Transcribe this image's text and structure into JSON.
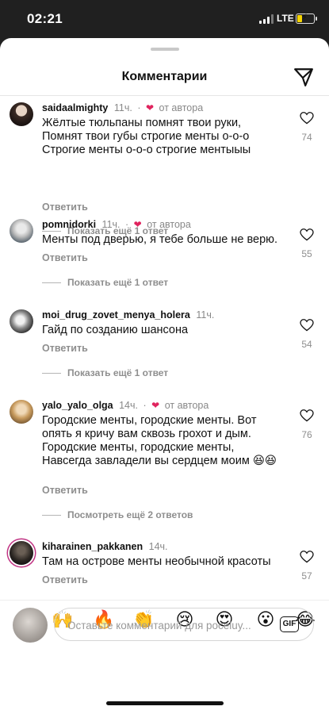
{
  "status_bar": {
    "time": "02:21",
    "network": "LTE"
  },
  "sheet": {
    "title": "Комментарии"
  },
  "comments": [
    {
      "username": "saidaalmighty",
      "time": "11ч.",
      "by_author": "от автора",
      "text": "Жёлтые тюльпаны помнят твои руки, Помнят твои губы строгие менты о-о-о Строгие менты о-о-о строгие ментыыы",
      "reply": "Ответить",
      "likes": "74",
      "more_replies": "Показать ещё 1 ответ"
    },
    {
      "username": "pomnidorki",
      "time": "11ч.",
      "by_author": "от автора",
      "text": "Менты под дверью, я тебе больше не верю.",
      "reply": "Ответить",
      "likes": "55",
      "more_replies": "Показать ещё 1 ответ"
    },
    {
      "username": "moi_drug_zovet_menya_holera",
      "time": "11ч.",
      "text": "Гайд по созданию шансона",
      "reply": "Ответить",
      "likes": "54",
      "more_replies": "Показать ещё 1 ответ"
    },
    {
      "username": "yalo_yalo_olga",
      "time": "14ч.",
      "by_author": "от автора",
      "text": "Городские менты, городские менты. Вот опять я кричу вам сквозь грохот и дым. Городские менты, городские менты, Навсегда завладели вы сердцем моим 😆😆",
      "reply": "Ответить",
      "likes": "76",
      "more_replies": "Посмотреть ещё 2 ответов"
    },
    {
      "username": "kiharainen_pakkanen",
      "time": "14ч.",
      "text": "Там на острове менты необычной красоты",
      "reply": "Ответить",
      "likes": "57"
    }
  ],
  "reactions": [
    "❤",
    "🙌",
    "🔥",
    "👏",
    "😢",
    "😍",
    "😮",
    "😂"
  ],
  "composer": {
    "placeholder": "Оставьте комментарий для poceluy...",
    "gif_label": "GIF"
  }
}
